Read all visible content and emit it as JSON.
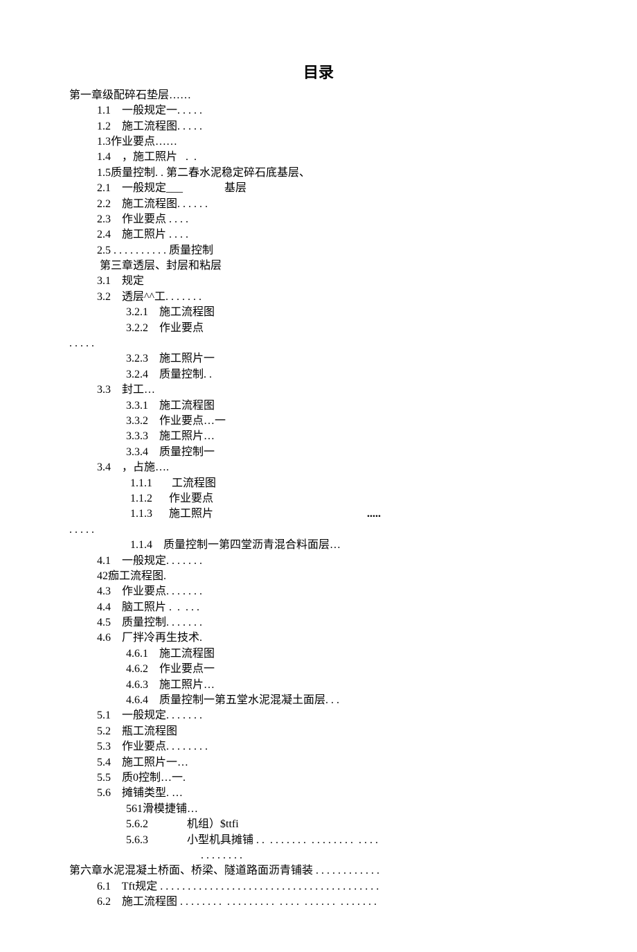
{
  "title": "目录",
  "lines": [
    {
      "cls": "l0",
      "text": "第一章级配碎石垫层……"
    },
    {
      "cls": "l1",
      "text": "1.1    一般规定一. . . . ."
    },
    {
      "cls": "l1",
      "text": "1.2    施工流程图. . . . ."
    },
    {
      "cls": "l1",
      "text": "1.3作业要点……"
    },
    {
      "cls": "l1",
      "text": "1.4    ，施工照片   .  ."
    },
    {
      "cls": "l1",
      "text": "1.5质量控制. . 第二春水泥稳定碎石底基层、"
    },
    {
      "cls": "l1",
      "text": "2.1    一般规定___               基层"
    },
    {
      "cls": "l1",
      "text": "2.2    施工流程图. . . . . ."
    },
    {
      "cls": "l1",
      "text": "2.3    作业要点 . . . ."
    },
    {
      "cls": "l1",
      "text": "2.4    施工照片 . . . ."
    },
    {
      "cls": "l1",
      "text": "2.5 . . . . . . . . . . 质量控制"
    },
    {
      "cls": "l1",
      "text": " 第三章透层、封层和粘层"
    },
    {
      "cls": "l1",
      "text": "3.1    规定"
    },
    {
      "cls": "l1",
      "text": "3.2    透层^^工. . . . . . ."
    },
    {
      "cls": "l3",
      "text": "3.2.1    施工流程图"
    },
    {
      "cls": "l3",
      "text": "3.2.2    作业要点"
    },
    {
      "cls": "l0",
      "text": ". . . . ."
    },
    {
      "cls": "l3",
      "text": "3.2.3    施工照片一"
    },
    {
      "cls": "l3",
      "text": "3.2.4    质量控制. ."
    },
    {
      "cls": "l1",
      "text": "3.3    封工…"
    },
    {
      "cls": "l3",
      "text": "3.3.1    施工流程图"
    },
    {
      "cls": "l3",
      "text": "3.3.2    作业要点…一"
    },
    {
      "cls": "l3",
      "text": "3.3.3    施工照片…"
    },
    {
      "cls": "l3",
      "text": "3.3.4    质量控制一"
    },
    {
      "cls": "l1",
      "text": "3.4    ，占施…."
    },
    {
      "cls": "l4",
      "text": "1.1.1       工流程图"
    },
    {
      "cls": "l4",
      "text": "1.1.2      作业要点"
    },
    {
      "cls": "l4",
      "text": "1.1.3      施工照片",
      "rightdots": "....."
    },
    {
      "cls": "l0",
      "text": ". . . . ."
    },
    {
      "cls": "l4",
      "text": "1.1.4    质量控制一第四堂沥青混合料面层…"
    },
    {
      "cls": "l1",
      "text": "4.1    一般规定. . . . . . ."
    },
    {
      "cls": "l1",
      "text": "42痂工流程图."
    },
    {
      "cls": "l1",
      "text": "4.3    作业要点. . . . . . ."
    },
    {
      "cls": "l1",
      "text": "4.4    脑工照片 .  .  . . ."
    },
    {
      "cls": "l1",
      "text": "4.5    质量控制. . . . . . ."
    },
    {
      "cls": "l1",
      "text": "4.6    厂拌冷再生技术."
    },
    {
      "cls": "l3",
      "text": "4.6.1    施工流程图"
    },
    {
      "cls": "l3",
      "text": "4.6.2    作业要点一"
    },
    {
      "cls": "l3",
      "text": "4.6.3    施工照片…"
    },
    {
      "cls": "l3",
      "text": "4.6.4    质量控制一第五堂水泥混凝土面层. . ."
    },
    {
      "cls": "l1",
      "text": "5.1    一般规定. . . . . . ."
    },
    {
      "cls": "l1",
      "text": "5.2    瓶工流程图"
    },
    {
      "cls": "l1",
      "text": "5.3    作业要点. . . . . . . ."
    },
    {
      "cls": "l1",
      "text": "5.4    施工照片一…"
    },
    {
      "cls": "l1",
      "text": "5.5    质0控制…一."
    },
    {
      "cls": "l1",
      "text": "5.6    摊铺类型. …"
    },
    {
      "cls": "l3",
      "text": "561滑模捷铺…"
    },
    {
      "cls": "l3",
      "text": "5.6.2              机组）$ttfi"
    },
    {
      "cls": "l3",
      "text": "5.6.3              小型机具摊铺 . .  . . . . . . .  . . . . . . . .  . . . ."
    },
    {
      "cls": "l3",
      "text": "                           . . . . . . . ."
    },
    {
      "cls": "l0",
      "text": "第六章水泥混凝土桥面、桥梁、隧道路面沥青铺装 . . . . . . . . . . . ."
    },
    {
      "cls": "l1",
      "text": "6.1    Tft规定 . . . . . . . . . . . . . . . . . . . . . . . . . . . . . . . . . . . . . . . ."
    },
    {
      "cls": "l1",
      "text": "6.2    施工流程图 . . . . . . . .  . . . . . . . . .  . . . .  . . . . . .  . . . . . . ."
    }
  ]
}
